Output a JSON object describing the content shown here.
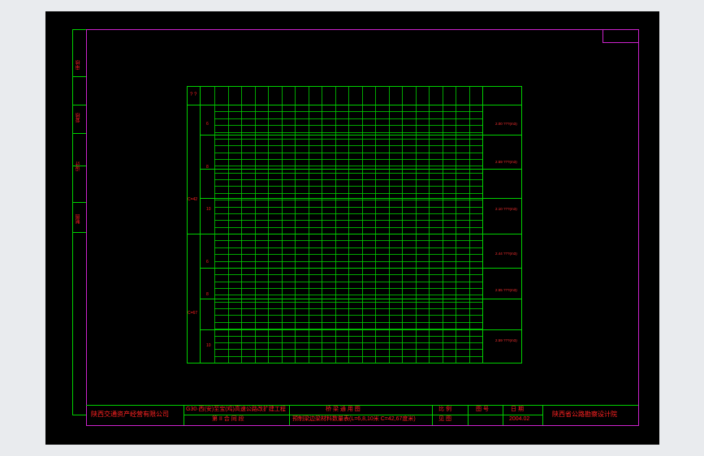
{
  "side_tabs": [
    {
      "label": "审核"
    },
    {
      "label": "复核"
    },
    {
      "label": "设计"
    },
    {
      "label": "制图"
    }
  ],
  "title_block": {
    "company": "陕西交通资产经营有限公司",
    "project_line1": "G30·西(安)至宝(鸡)高速公路改扩建工程",
    "project_line2": "第 II 合 同 段",
    "drawing_title": "桥 梁 通 用 图",
    "drawing_subtitle": "预制梁边梁材料数量表(L=6,8,10米 C=42,67度米)",
    "scale_label": "比 例",
    "scale_value": "见 图",
    "sheet_label": "图 号",
    "date_label": "日 期",
    "date_value": "2004.02",
    "designer": "陕西省公路勘察设计院"
  },
  "table": {
    "corner_label": "? ?",
    "group_labels": [
      "C=42",
      "C=67"
    ],
    "span_labels": [
      "6",
      "8",
      "10"
    ],
    "side_notes": [
      "2.00 ???(m3)",
      "2.59 ???(m3)",
      "2.10 ???(m3)",
      "2.44 ???(m3)",
      "2.55 ???(m3)",
      "2.59 ???(m3)"
    ]
  }
}
